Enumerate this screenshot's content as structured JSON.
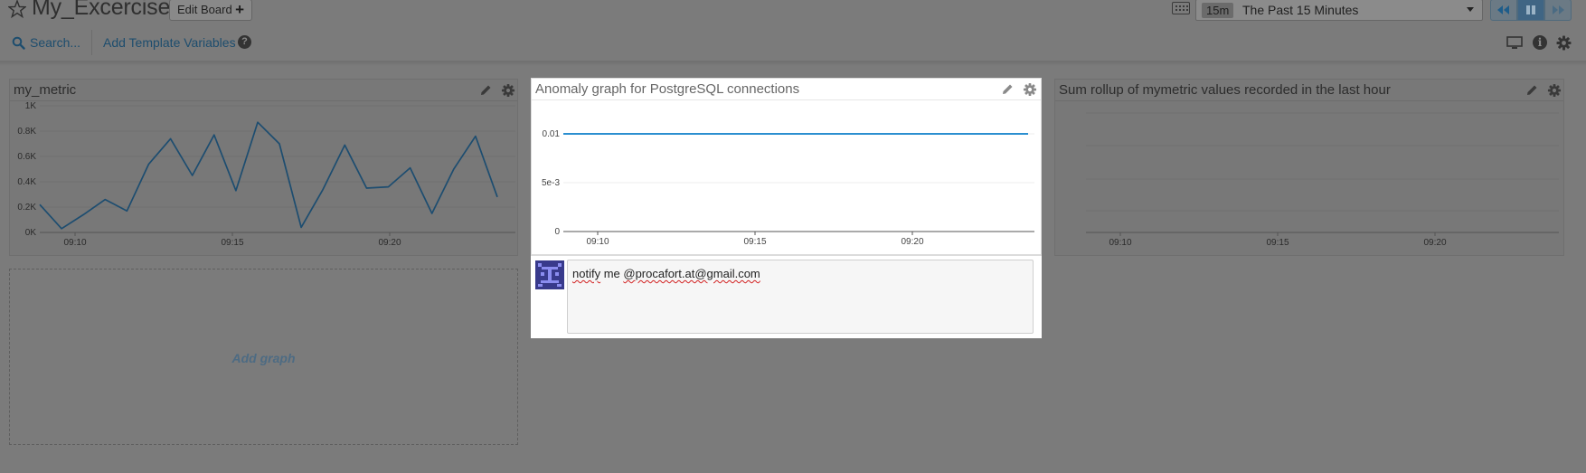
{
  "header": {
    "board_title": "My_Excercise",
    "edit_board_label": "Edit Board",
    "timeframe_badge": "15m",
    "timeframe_label": "The Past 15 Minutes"
  },
  "toolbar": {
    "search_label": "Search...",
    "template_vars_label": "Add Template Variables"
  },
  "widgets": {
    "my_metric": {
      "title": "my_metric",
      "y_ticks": [
        "1K",
        "0.8K",
        "0.6K",
        "0.4K",
        "0.2K",
        "0K"
      ],
      "x_ticks": [
        "09:10",
        "09:15",
        "09:20"
      ]
    },
    "anomaly": {
      "title": "Anomaly graph for PostgreSQL connections",
      "y_ticks": [
        "0.01",
        "5e-3",
        "0"
      ],
      "x_ticks": [
        "09:10",
        "09:15",
        "09:20"
      ]
    },
    "rollup": {
      "title": "Sum rollup of mymetric values recorded in the last hour",
      "x_ticks": [
        "09:10",
        "09:15",
        "09:20"
      ]
    }
  },
  "comment": {
    "word_notify": "notify",
    "word_me": " me ",
    "handle": "@procafort.at@gmail.com"
  },
  "add_graph_label": "Add graph",
  "colors": {
    "series_line": "#1d4d70",
    "anomaly_line": "#2b8fd0",
    "link": "#1d4d6e"
  },
  "chart_data": [
    {
      "type": "line",
      "title": "my_metric",
      "x": [
        "09:08:30",
        "09:09:00",
        "09:09:30",
        "09:10:00",
        "09:10:30",
        "09:11:00",
        "09:11:30",
        "09:12:00",
        "09:12:30",
        "09:13:00",
        "09:13:30",
        "09:14:00",
        "09:14:30",
        "09:15:00",
        "09:15:30",
        "09:16:00",
        "09:16:30",
        "09:17:00",
        "09:17:30",
        "09:18:00",
        "09:18:30",
        "09:19:00",
        "09:19:30",
        "09:20:00",
        "09:20:30",
        "09:21:00",
        "09:21:30",
        "09:22:00",
        "09:22:30"
      ],
      "series": [
        {
          "values": [
            220,
            30,
            140,
            260,
            170,
            540,
            740,
            450,
            770,
            330,
            870,
            700,
            40,
            340,
            690,
            350,
            360,
            510,
            150,
            500,
            760,
            280
          ]
        }
      ],
      "y_ticks": [
        "0K",
        "0.2K",
        "0.4K",
        "0.6K",
        "0.8K",
        "1K"
      ],
      "ylim": [
        0,
        1000
      ],
      "grid": true
    },
    {
      "type": "line",
      "title": "Anomaly graph for PostgreSQL connections",
      "x_ticks": [
        "09:10",
        "09:15",
        "09:20"
      ],
      "series": [
        {
          "values": [
            0.01,
            0.01,
            0.01,
            0.01,
            0.01,
            0.01,
            0.01,
            0.01,
            0.01,
            0.01,
            0.01,
            0.01,
            0.01,
            0.01
          ]
        }
      ],
      "y_ticks": [
        "0",
        "5e-3",
        "0.01"
      ],
      "ylim": [
        0,
        0.01
      ],
      "grid": true
    },
    {
      "type": "line",
      "title": "Sum rollup of mymetric values recorded in the last hour",
      "x_ticks": [
        "09:10",
        "09:15",
        "09:20"
      ],
      "series": [],
      "grid": true
    }
  ]
}
